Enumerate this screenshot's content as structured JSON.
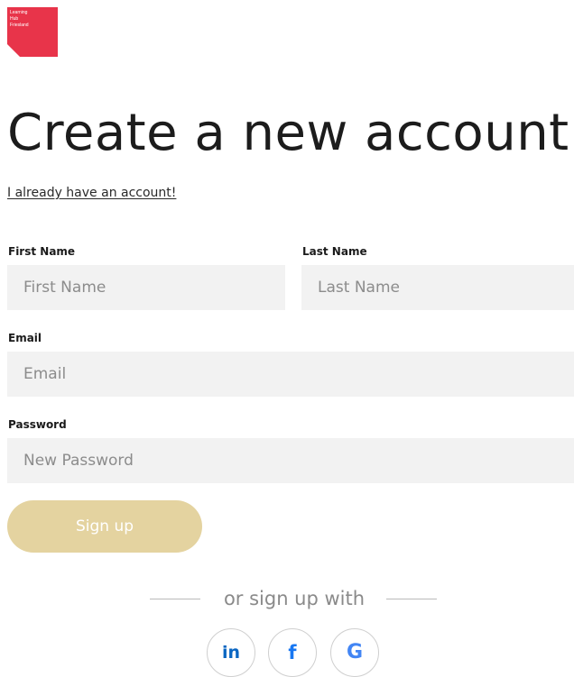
{
  "logo": {
    "lines": [
      "Learning",
      "Hub",
      "Friesland"
    ]
  },
  "page": {
    "title": "Create a new account",
    "login_link": "I already have an account!"
  },
  "form": {
    "first_name": {
      "label": "First Name",
      "placeholder": "First Name",
      "value": ""
    },
    "last_name": {
      "label": "Last Name",
      "placeholder": "Last Name",
      "value": ""
    },
    "email": {
      "label": "Email",
      "placeholder": "Email",
      "value": ""
    },
    "password": {
      "label": "Password",
      "placeholder": "New Password",
      "value": ""
    },
    "submit_label": "Sign up"
  },
  "social": {
    "divider_text": "or sign up with",
    "providers": [
      {
        "name": "linkedin",
        "glyph": "in",
        "icon": "linkedin-icon",
        "color": "#0a66c2"
      },
      {
        "name": "facebook",
        "glyph": "f",
        "icon": "facebook-icon",
        "color": "#1877f2"
      },
      {
        "name": "google",
        "glyph": "G",
        "icon": "google-icon",
        "color": "#4285f4"
      }
    ]
  },
  "colors": {
    "brand": "#e8344a",
    "button": "#e4d3a0",
    "field_background": "#f2f2f2"
  }
}
